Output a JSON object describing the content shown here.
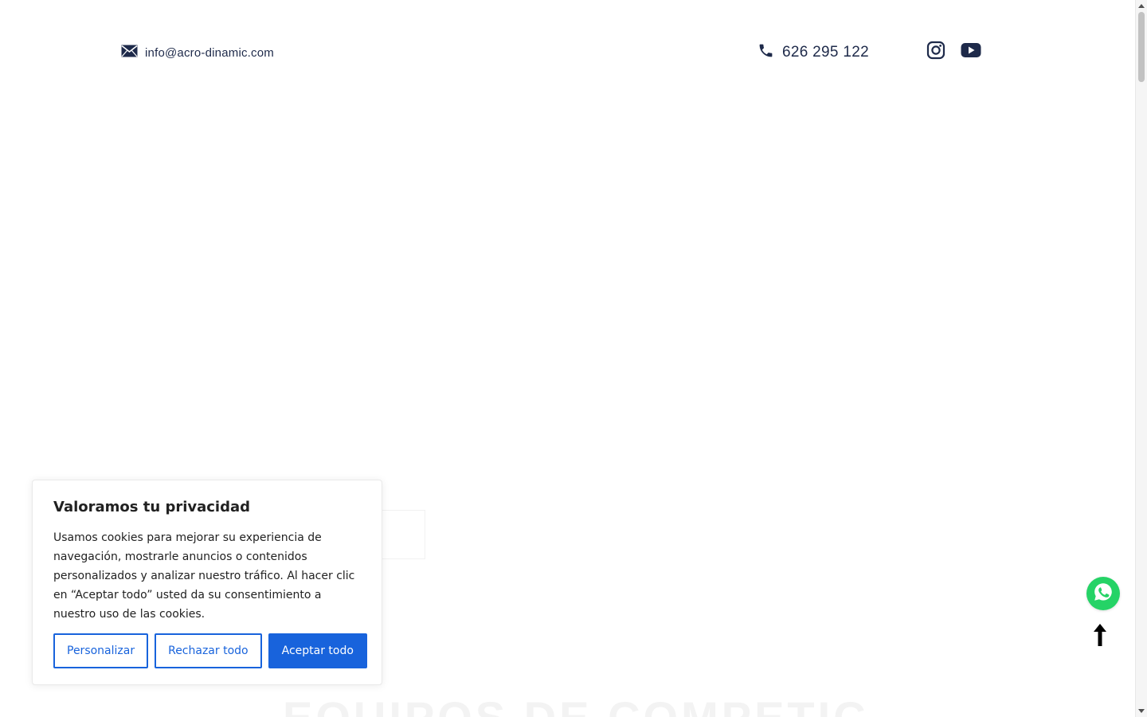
{
  "topbar": {
    "email": "info@acro-dinamic.com",
    "phone": "626 295 122",
    "icons": {
      "email": "envelope-icon",
      "phone": "phone-icon",
      "instagram": "instagram-icon",
      "youtube": "youtube-icon"
    },
    "text_color": "#1e2a4a"
  },
  "hero": {
    "heading": "EQUIPOS DE COMPETICIÓN"
  },
  "cookie_banner": {
    "title": "Valoramos tu privacidad",
    "text": "Usamos cookies para mejorar su experiencia de navegación, mostrarle anuncios o contenidos personalizados y analizar nuestro tráfico. Al hacer clic en “Aceptar todo” usted da su consentimiento a nuestro uso de las cookies.",
    "buttons": {
      "customize": "Personalizar",
      "reject": "Rechazar todo",
      "accept": "Aceptar todo"
    },
    "accent_color": "#1863dc"
  },
  "floating": {
    "whatsapp_icon": "whatsapp-icon",
    "whatsapp_color": "#25d366",
    "scroll_top_icon": "arrow-up-icon"
  }
}
